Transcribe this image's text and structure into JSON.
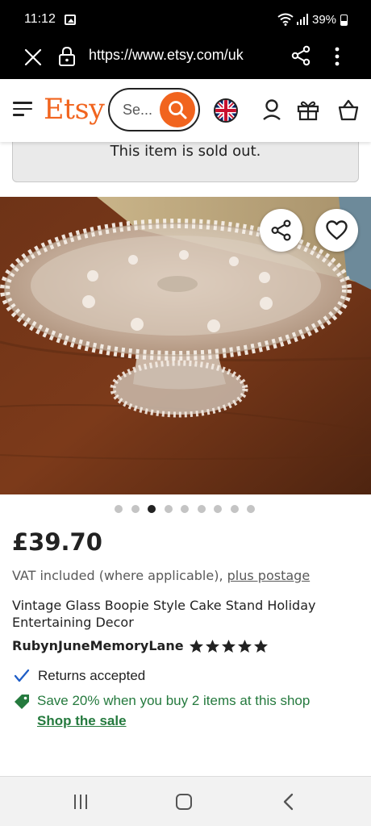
{
  "status_bar": {
    "time": "11:12",
    "battery": "39%"
  },
  "browser": {
    "url": "https://www.etsy.com/uk"
  },
  "header": {
    "logo": "Etsy",
    "search_placeholder": "Se..."
  },
  "banner": {
    "sold_out": "This item is sold out."
  },
  "carousel": {
    "total": 9,
    "active_index": 2
  },
  "product": {
    "price": "£39.70",
    "vat_text": "VAT included (where applicable),",
    "vat_link": "plus postage",
    "title": "Vintage Glass Boopie Style Cake Stand Holiday Entertaining Decor",
    "shop_name": "RubynJuneMemoryLane",
    "rating": 5,
    "returns": "Returns accepted",
    "promo": "Save 20% when you buy 2 items at this shop",
    "promo_link": "Shop the sale"
  },
  "colors": {
    "brand_orange": "#f1641e",
    "promo_green": "#257a3e",
    "link_blue": "#1f5ec7"
  },
  "icons": {
    "status": [
      "gallery-icon",
      "wifi-icon",
      "signal-icon",
      "battery-icon"
    ],
    "browser": [
      "close-icon",
      "lock-icon",
      "share-icon",
      "menu-icon"
    ],
    "header": [
      "hamburger-icon",
      "search-icon",
      "uk-flag-icon",
      "user-icon",
      "gift-icon",
      "bag-icon"
    ],
    "image": [
      "share-icon",
      "heart-icon"
    ],
    "nav": [
      "recents-icon",
      "home-icon",
      "back-icon"
    ]
  }
}
